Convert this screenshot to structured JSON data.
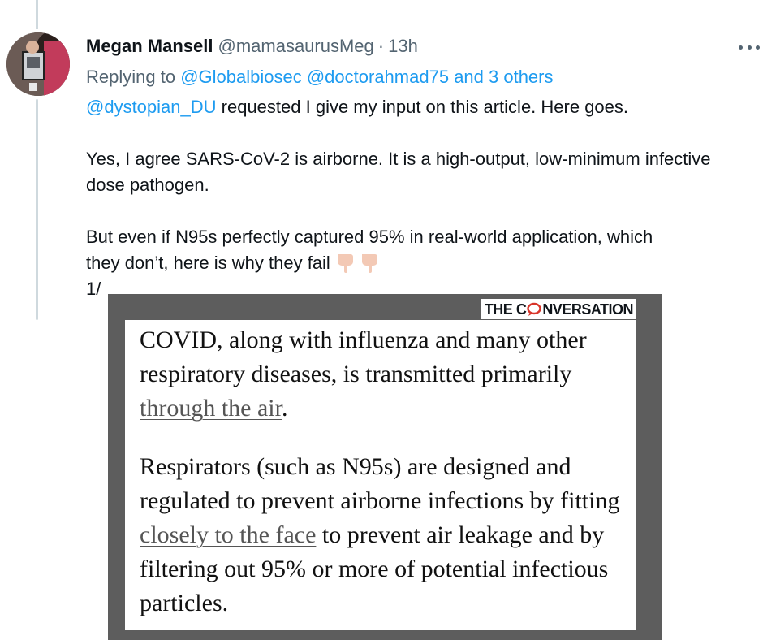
{
  "tweet": {
    "author_name": "Megan Mansell",
    "handle": "@mamasaurusMeg",
    "separator": "·",
    "time": "13h",
    "replying_prefix": "Replying to ",
    "replying_to": [
      {
        "label": "@Globalbiosec"
      },
      {
        "label": "@doctorahmad75"
      },
      {
        "label": "and 3 others"
      }
    ],
    "mention": "@dystopian_DU",
    "line1_rest": " requested I give my input on this article. Here goes.",
    "para2": "Yes, I agree SARS-CoV-2 is airborne. It is a high-output, low-minimum infective dose pathogen.",
    "para3_line1": "But even if N95s perfectly captured 95% in real-world application, which",
    "para3_line2": "they don’t, here is why they fail",
    "emoji_name": "backhand-index-pointing-down-icon",
    "thread_counter": "1/"
  },
  "image": {
    "logo_part1": "THE C",
    "logo_part2": "NVERSATION",
    "p1_before": "COVID, along with influenza and many other respiratory diseases, is transmitted primarily ",
    "p1_link": "through the air",
    "p1_after": ".",
    "p2_before": "Respirators (such as N95s) are designed and regulated to prevent airborne infections by fitting ",
    "p2_link": "closely to the face",
    "p2_after": " to prevent air leakage and by filtering out 95% or more of potential infectious particles."
  },
  "colors": {
    "link": "#1d9bf0",
    "secondary_text": "#536471",
    "thread_line": "#cfd9de",
    "card_background": "#5d5d5d",
    "logo_accent": "#d8352a"
  }
}
